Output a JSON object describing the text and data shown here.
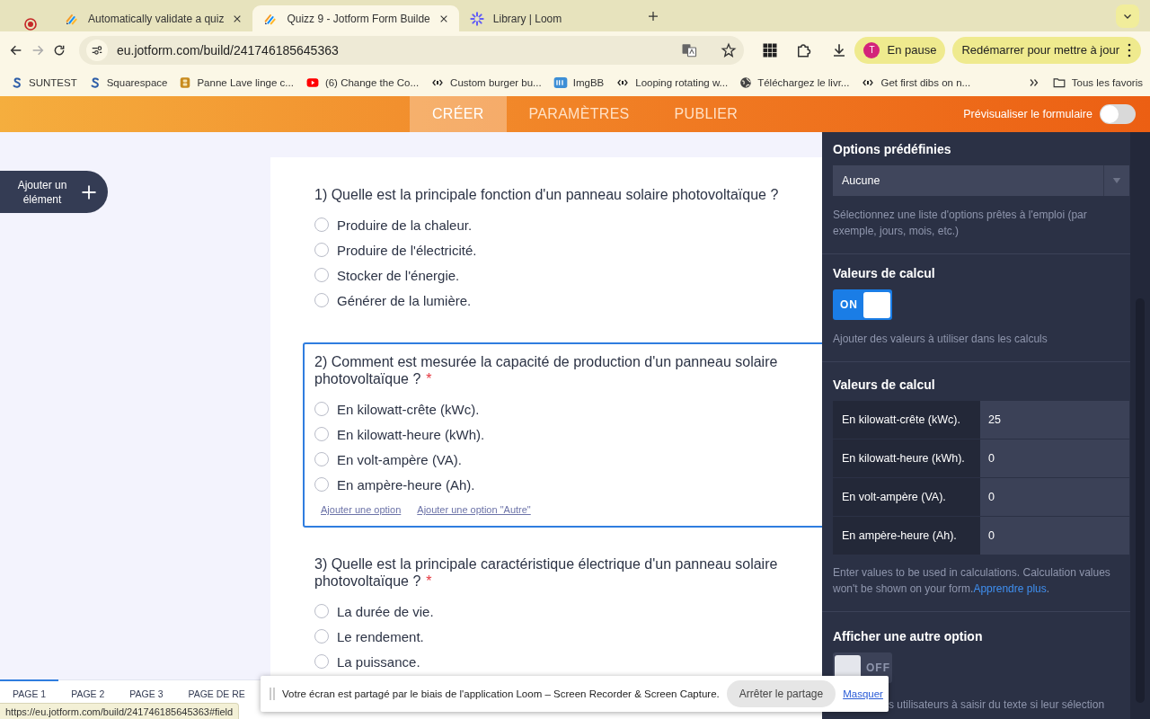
{
  "browser": {
    "tabs": [
      {
        "title": "Automatically validate a quiz",
        "kind": "jotform",
        "selected": false
      },
      {
        "title": "Quizz 9 - Jotform Form Builde",
        "kind": "jotform",
        "selected": true
      },
      {
        "title": "Library | Loom",
        "kind": "loom",
        "selected": false
      }
    ],
    "url": "eu.jotform.com/build/241746185645363",
    "profile": {
      "initial": "T",
      "label": "En pause"
    },
    "update_button": "Redémarrer pour mettre à jour",
    "bookmarks": [
      {
        "label": "SUNTEST",
        "kind": "s"
      },
      {
        "label": "Squarespace",
        "kind": "s"
      },
      {
        "label": "Panne Lave linge c...",
        "kind": "b"
      },
      {
        "label": "(6) Change the Co...",
        "kind": "video"
      },
      {
        "label": "Custom burger bu...",
        "kind": "code"
      },
      {
        "label": "ImgBB",
        "kind": "ibb"
      },
      {
        "label": "Looping rotating w...",
        "kind": "code"
      },
      {
        "label": "Téléchargez le livr...",
        "kind": "globe"
      },
      {
        "label": "Get first dibs on n...",
        "kind": "code"
      }
    ],
    "bookmarks_folder": "Tous les favoris"
  },
  "builder": {
    "nav": [
      {
        "label": "CRÉER",
        "selected": true
      },
      {
        "label": "PARAMÈTRES",
        "selected": false
      },
      {
        "label": "PUBLIER",
        "selected": false
      }
    ],
    "preview": {
      "label": "Prévisualiser le formulaire",
      "on": false
    },
    "add_element": "Ajouter un élément",
    "questions": [
      {
        "title": "1) Quelle est la principale fonction d'un panneau solaire photovoltaïque ?",
        "selected": false,
        "options": [
          "Produire de la chaleur.",
          "Produire de l'électricité.",
          "Stocker de l'énergie.",
          "Générer de la lumière."
        ]
      },
      {
        "title": "2) Comment est mesurée la capacité de production d'un panneau solaire photovoltaïque ?",
        "required_mark": "*",
        "selected": true,
        "options": [
          "En kilowatt-crête (kWc).",
          "En kilowatt-heure (kWh).",
          "En volt-ampère (VA).",
          "En ampère-heure (Ah)."
        ],
        "links": [
          "Ajouter une option",
          "Ajouter une option \"Autre\""
        ]
      },
      {
        "title": "3) Quelle est la principale caractéristique électrique d'un panneau solaire photovoltaïque ?",
        "required_mark": "*",
        "selected": false,
        "options": [
          "La durée de vie.",
          "Le rendement.",
          "La puissance."
        ]
      }
    ],
    "pages": [
      {
        "label": "PAGE 1",
        "selected": true
      },
      {
        "label": "PAGE 2",
        "selected": false
      },
      {
        "label": "PAGE 3",
        "selected": false
      },
      {
        "label": "PAGE DE RE",
        "selected": false
      }
    ]
  },
  "panel": {
    "predefined": {
      "title": "Options prédéfinies",
      "value": "Aucune",
      "hint": "Sélectionnez une liste d'options prêtes à l'emploi (par exemple, jours, mois, etc.)"
    },
    "calc_toggle": {
      "title": "Valeurs de calcul",
      "on": true,
      "label": "ON",
      "hint": "Ajouter des valeurs à utiliser dans les calculs"
    },
    "calc_values": {
      "title": "Valeurs de calcul",
      "rows": [
        {
          "label": "En kilowatt-crête (kWc).",
          "value": "25"
        },
        {
          "label": "En kilowatt-heure (kWh).",
          "value": "0"
        },
        {
          "label": "En volt-ampère (VA).",
          "value": "0"
        },
        {
          "label": "En ampère-heure (Ah).",
          "value": "0"
        }
      ],
      "hint": "Enter values to be used in calculations. Calculation values won't be shown on your form.",
      "link": "Apprendre plus",
      "hint_end": "."
    },
    "other_option": {
      "title": "Afficher une autre option",
      "on": false,
      "label": "OFF",
      "hint": "s utilisateurs à saisir du texte si leur sélection"
    }
  },
  "share_bar": {
    "message": "Votre écran est partagé par le biais de l'application Loom – Screen Recorder & Screen Capture.",
    "stop_button": "Arrêter le partage",
    "hide_link": "Masquer"
  },
  "status_url": "https://eu.jotform.com/build/241746185645363#field"
}
